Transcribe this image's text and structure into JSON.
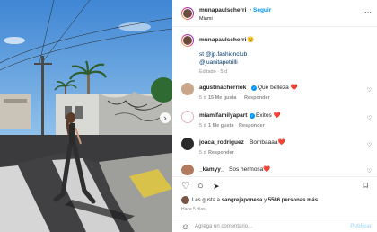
{
  "post": {
    "username": "munapaulscherri",
    "follow_label": "Seguir",
    "location": "Miami",
    "caption": {
      "emoji": "😊",
      "line1": "st @jp.fashionclub",
      "line2": "@juanitapetrilli",
      "meta": "Editado · 5 d"
    }
  },
  "comments": [
    {
      "username": "agustinacherriok",
      "verified": true,
      "text": "Que belleza ❤️",
      "age": "5 d",
      "likes": "15 Me gusta",
      "reply": "Responder"
    },
    {
      "username": "miamifamilyapart",
      "verified": true,
      "text": "Éxitos ❤️",
      "age": "5 d",
      "likes": "1 Me gusta",
      "reply": "Responder"
    },
    {
      "username": "joaca_rodriguez",
      "verified": false,
      "text": "Bombaaaa❤️",
      "age": "5 d",
      "likes": "",
      "reply": "Responder"
    },
    {
      "username": "_kamyy_",
      "verified": false,
      "text": "Sos hermosa❤️",
      "age": "",
      "likes": "",
      "reply": ""
    }
  ],
  "likes_line": {
    "prefix": "Les gusta a",
    "user": "sangrejaponesa",
    "connector": "y",
    "others": "5566 personas más"
  },
  "posted_ago": "Hace 5 días",
  "add_comment": {
    "placeholder": "Agrega un comentario...",
    "publish_label": "Publicar"
  },
  "icons": {
    "verified": "✓",
    "heart": "♡",
    "next": "›",
    "more": "···",
    "comment": "○",
    "share": "➤",
    "save": "⌑",
    "emoji": "☺"
  },
  "colors": {
    "accent": "#0095f6",
    "link": "#00376b",
    "muted": "#8e8e8e"
  }
}
